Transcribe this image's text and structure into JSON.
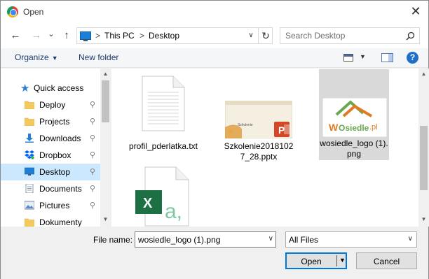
{
  "window": {
    "title": "Open",
    "close_glyph": "✕"
  },
  "nav": {
    "back_glyph": "←",
    "forward_glyph": "→",
    "recent_glyph": "⌄",
    "up_glyph": "↑",
    "breadcrumb": [
      "This PC",
      "Desktop"
    ],
    "breadcrumb_sep": ">",
    "address_dropdown_glyph": "∨",
    "refresh_glyph": "↻",
    "search_placeholder": "Search Desktop"
  },
  "toolbar": {
    "organize_label": "Organize",
    "organize_caret": "▼",
    "new_folder_label": "New folder",
    "view_caret": "▼",
    "help_label": "?"
  },
  "sidebar": {
    "items": [
      {
        "label": "Quick access",
        "icon": "star-icon",
        "pinned": false
      },
      {
        "label": "Deploy",
        "icon": "folder-icon",
        "pinned": true
      },
      {
        "label": "Projects",
        "icon": "folder-icon",
        "pinned": true
      },
      {
        "label": "Downloads",
        "icon": "download-icon",
        "pinned": true
      },
      {
        "label": "Dropbox",
        "icon": "dropbox-icon",
        "pinned": true
      },
      {
        "label": "Desktop",
        "icon": "desktop-icon",
        "pinned": true,
        "selected": true
      },
      {
        "label": "Documents",
        "icon": "documents-icon",
        "pinned": true
      },
      {
        "label": "Pictures",
        "icon": "pictures-icon",
        "pinned": true
      },
      {
        "label": "Dokumenty",
        "icon": "folder-icon",
        "pinned": false
      }
    ],
    "pin_glyph": "📌",
    "scroll_up_glyph": "▲",
    "scroll_down_glyph": "▼"
  },
  "files": [
    {
      "name": "profil_pderlatka.txt",
      "type": "text-file-icon"
    },
    {
      "name": "Szkolenie20181027_28.pptx",
      "type": "powerpoint-thumbnail",
      "thumb_title": "Szkolenie"
    },
    {
      "name": "wosiedle_logo (1).png",
      "type": "logo-thumbnail",
      "selected": true,
      "logo_text_w": "W",
      "logo_text_rest": "Osiedle",
      "logo_text_pl": ".pl"
    },
    {
      "name": "",
      "type": "excel-file-icon"
    }
  ],
  "main_scroll": {
    "up_glyph": "▲",
    "down_glyph": "▼"
  },
  "bottom": {
    "file_name_label": "File name:",
    "file_name_value": "wosiedle_logo (1).png",
    "file_name_dropdown_glyph": "∨",
    "filter_value": "All Files",
    "filter_dropdown_glyph": "∨",
    "open_label": "Open",
    "open_caret": "▼",
    "cancel_label": "Cancel"
  },
  "colors": {
    "selection": "#cce8ff",
    "file_selected": "#d9d9d9",
    "accent": "#0078d7",
    "excel_green": "#1d7044",
    "powerpoint_orange": "#d24726"
  }
}
